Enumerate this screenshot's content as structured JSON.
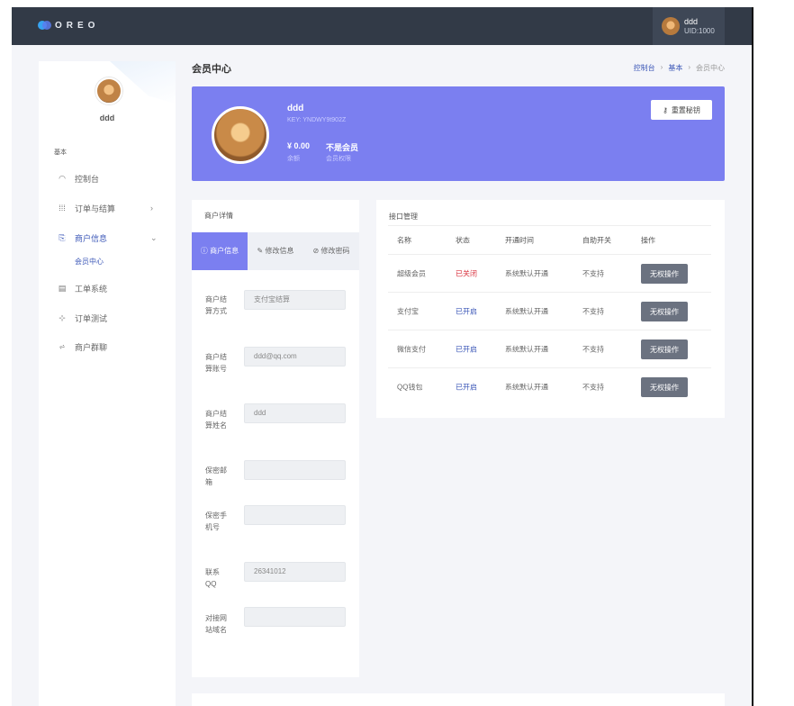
{
  "brand": {
    "logo_text": "OREO"
  },
  "topbar_user": {
    "name": "ddd",
    "uid": "UID:1000"
  },
  "sidebar": {
    "user_name": "ddd",
    "section": "基本",
    "items": [
      {
        "label": "控制台",
        "icon": "dashboard-icon"
      },
      {
        "label": "订单与结算",
        "icon": "grid-icon",
        "arrow": "›"
      },
      {
        "label": "商户信息",
        "icon": "merchant-icon",
        "arrow": "⌄"
      },
      {
        "label": "工单系统",
        "icon": "ticket-icon"
      },
      {
        "label": "订单测试",
        "icon": "test-icon"
      },
      {
        "label": "商户群聊",
        "icon": "group-icon"
      }
    ],
    "sub_item": "会员中心"
  },
  "page": {
    "title": "会员中心",
    "breadcrumb": [
      "控制台",
      "基本",
      "会员中心"
    ]
  },
  "profile": {
    "name": "ddd",
    "key": "KEY: YNDWY9t902Z",
    "balance": "¥ 0.00",
    "balance_label": "余额",
    "membership": "不是会员",
    "membership_label": "会员权限",
    "reset_button": "重置秘钥"
  },
  "merchant": {
    "title": "商户详情",
    "tabs": [
      "商户信息",
      "修改信息",
      "修改密码"
    ],
    "fields": [
      {
        "label": "商户结算方式",
        "value": "支付宝结算"
      },
      {
        "label": "商户结算账号",
        "value": "ddd@qq.com"
      },
      {
        "label": "商户结算姓名",
        "value": "ddd"
      },
      {
        "label": "保密邮箱",
        "value": ""
      },
      {
        "label": "保密手机号",
        "value": ""
      },
      {
        "label": "联系QQ",
        "value": "26341012"
      },
      {
        "label": "对接网站域名",
        "value": ""
      }
    ]
  },
  "api": {
    "title": "接口管理",
    "columns": [
      "名称",
      "状态",
      "开通时间",
      "自助开关",
      "操作"
    ],
    "rows": [
      {
        "name": "超级会员",
        "status": "已关闭",
        "time": "系统默认开通",
        "auto": "不支持",
        "op": "无权操作"
      },
      {
        "name": "支付宝",
        "status": "已开启",
        "time": "系统默认开通",
        "auto": "不支持",
        "op": "无权操作"
      },
      {
        "name": "微信支付",
        "status": "已开启",
        "time": "系统默认开通",
        "auto": "不支持",
        "op": "无权操作"
      },
      {
        "name": "QQ钱包",
        "status": "已开启",
        "time": "系统默认开通",
        "auto": "不支持",
        "op": "无权操作"
      }
    ]
  },
  "colors": {
    "primary": "#7b7ff0",
    "topbar": "#323a47",
    "accent": "#3e59b8",
    "danger": "#d9333f"
  }
}
